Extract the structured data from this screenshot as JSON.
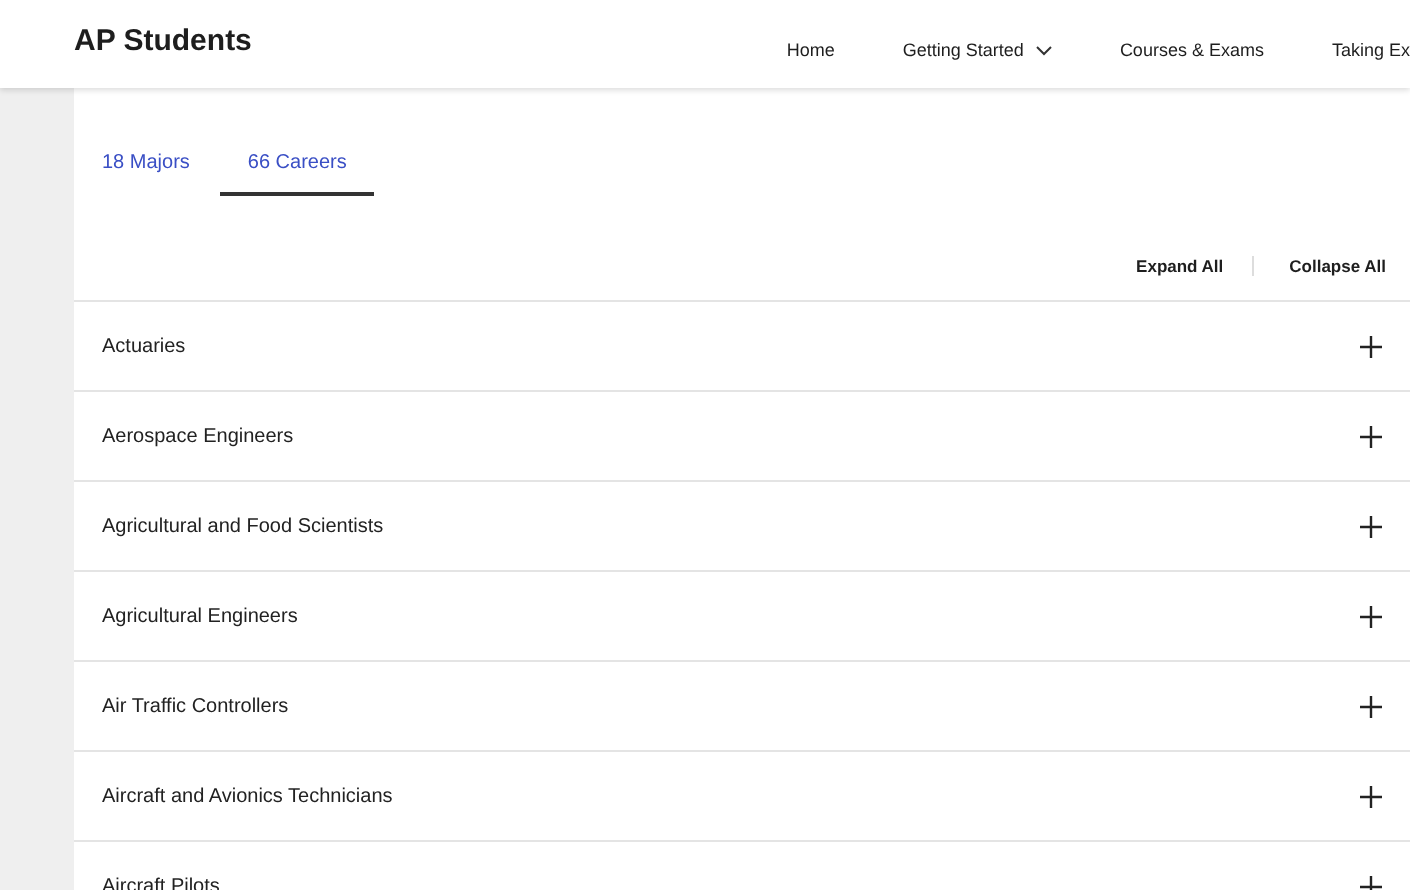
{
  "header": {
    "title": "AP Students",
    "nav": [
      {
        "label": "Home",
        "kind": "link"
      },
      {
        "label": "Getting Started",
        "kind": "dropdown"
      },
      {
        "label": "Courses & Exams",
        "kind": "link"
      },
      {
        "label": "Taking Ex",
        "kind": "link"
      }
    ]
  },
  "tabs": [
    {
      "label": "18 Majors",
      "selected": false
    },
    {
      "label": "66 Careers",
      "selected": true
    }
  ],
  "actions": [
    "Expand All",
    "Collapse All"
  ],
  "careers": [
    {
      "name": "Actuaries",
      "expanded": false
    },
    {
      "name": "Aerospace Engineers",
      "expanded": false
    },
    {
      "name": "Agricultural and Food Scientists",
      "expanded": false
    },
    {
      "name": "Agricultural Engineers",
      "expanded": false
    },
    {
      "name": "Air Traffic Controllers",
      "expanded": false
    },
    {
      "name": "Aircraft and Avionics Technicians",
      "expanded": false
    },
    {
      "name": "Aircraft Pilots",
      "expanded": false
    }
  ]
}
